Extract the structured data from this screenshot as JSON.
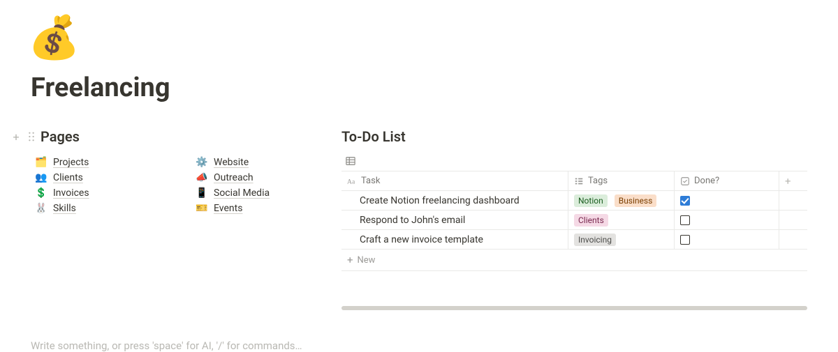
{
  "page": {
    "icon": "💰",
    "title": "Freelancing",
    "placeholder": "Write something, or press 'space' for AI, '/' for commands…"
  },
  "pages": {
    "heading": "Pages",
    "colA": [
      {
        "emoji": "🗂️",
        "label": "Projects"
      },
      {
        "emoji": "👥",
        "label": "Clients"
      },
      {
        "emoji": "💲",
        "label": "Invoices"
      },
      {
        "emoji": "🐰",
        "label": "Skills"
      }
    ],
    "colB": [
      {
        "emoji": "⚙️",
        "label": "Website"
      },
      {
        "emoji": "📣",
        "label": "Outreach"
      },
      {
        "emoji": "📱",
        "label": "Social Media"
      },
      {
        "emoji": "🎫",
        "label": "Events"
      }
    ]
  },
  "todo": {
    "heading": "To-Do List",
    "columns": {
      "task": "Task",
      "tags": "Tags",
      "done": "Done?"
    },
    "new_label": "New",
    "rows": [
      {
        "task": "Create Notion freelancing dashboard",
        "tags": [
          {
            "label": "Notion",
            "bg": "#dbeddb",
            "fg": "#1b5e20"
          },
          {
            "label": "Business",
            "bg": "#fadec9",
            "fg": "#7a3e00"
          }
        ],
        "done": true
      },
      {
        "task": "Respond to John's email",
        "tags": [
          {
            "label": "Clients",
            "bg": "#f5d9e5",
            "fg": "#7a2a50"
          }
        ],
        "done": false
      },
      {
        "task": "Craft a new invoice template",
        "tags": [
          {
            "label": "Invoicing",
            "bg": "#e3e2e0",
            "fg": "#4d4d4b"
          }
        ],
        "done": false
      }
    ]
  }
}
